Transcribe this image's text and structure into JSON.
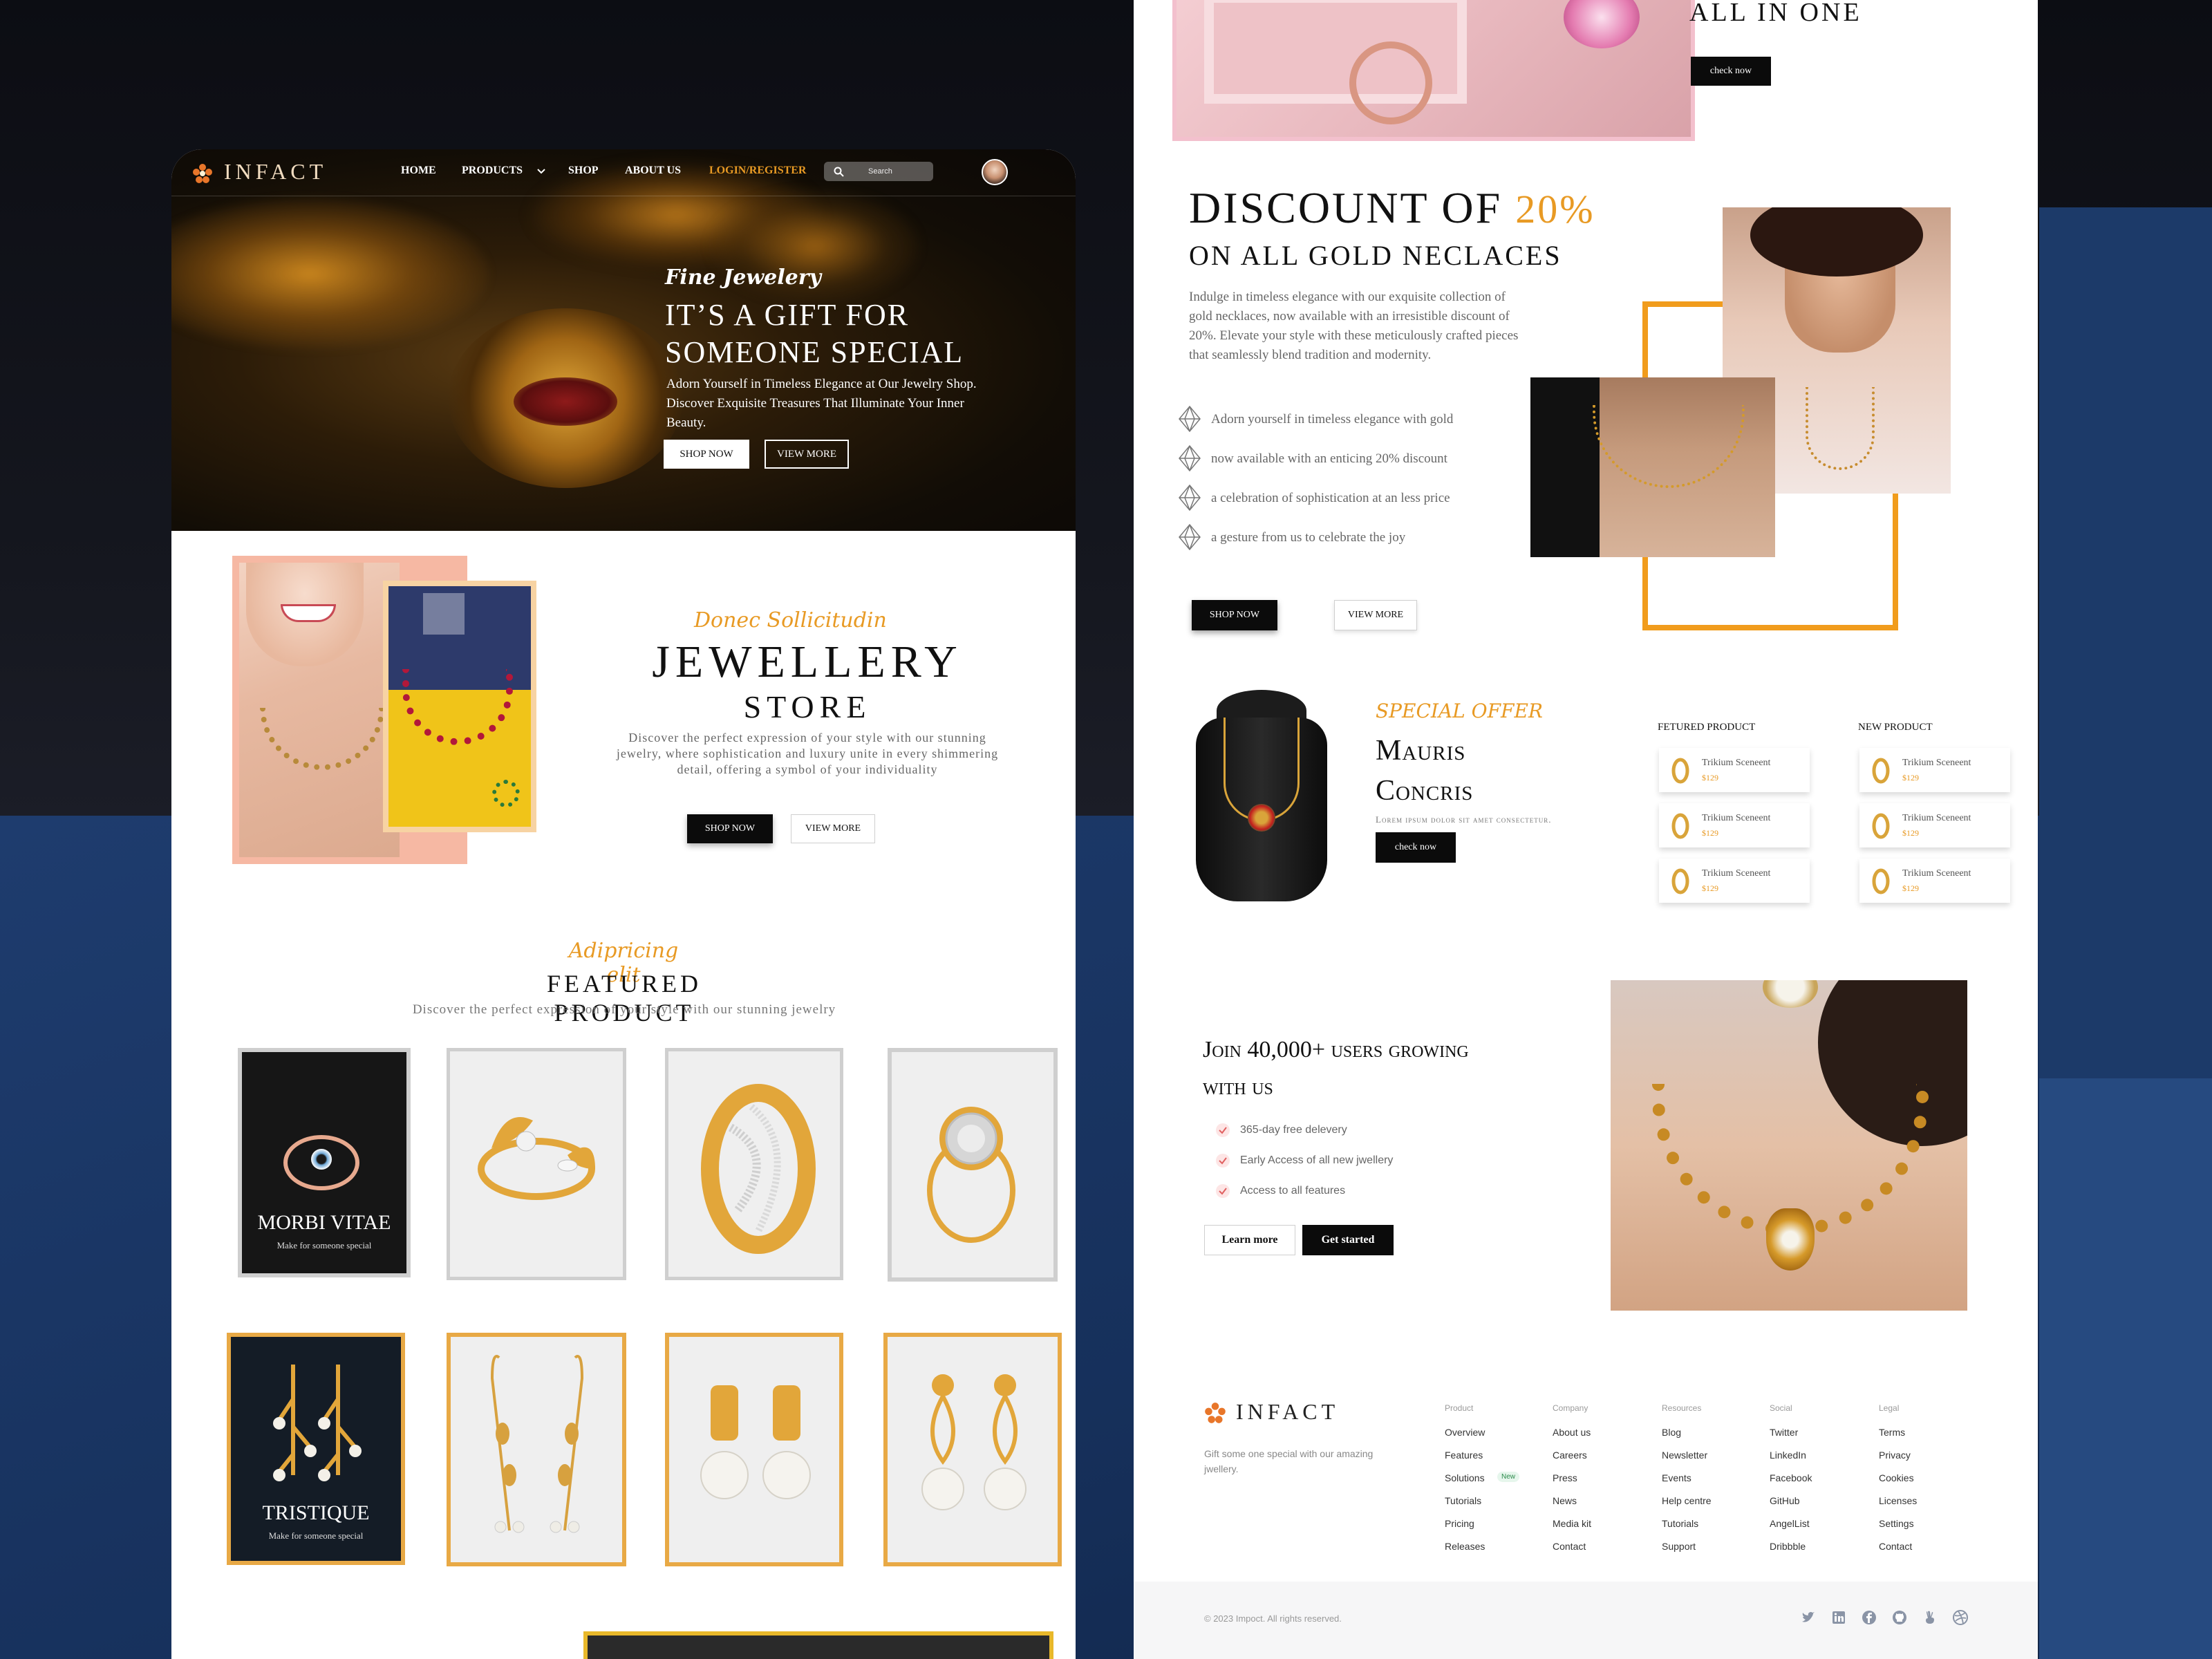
{
  "brand": {
    "name": "INFACT"
  },
  "nav": {
    "home": "HOME",
    "products": "PRODUCTS",
    "shop": "SHOP",
    "about": "ABOUT US",
    "login": "LOGIN/REGISTER",
    "search_placeholder": "Search"
  },
  "hero": {
    "script": "Fine Jewelery",
    "title_line1": "IT’S A GIFT FOR",
    "title_line2": "SOMEONE  SPECIAL",
    "desc": "Adorn Yourself in Timeless Elegance at Our Jewelry Shop. Discover Exquisite Treasures That Illuminate Your Inner Beauty.",
    "shop_now": "SHOP NOW",
    "view_more": "VIEW MORE"
  },
  "store": {
    "script": "Donec Sollicitudin",
    "title": "JEWELLERY",
    "subtitle": "STORE",
    "desc": "Discover the perfect expression of your style with our stunning jewelry, where sophistication and luxury unite in every shimmering detail, offering a symbol of your individuality",
    "shop_now": "SHOP NOW",
    "view_more": "VIEW MORE"
  },
  "featured": {
    "script": "Adipricing elit",
    "title": "FEATURED PRODUCT",
    "desc": "Discover the perfect expression of your style with our stunning jewelry",
    "card1": {
      "title": "MORBI VITAE",
      "sub": "Make for someone special"
    },
    "card5": {
      "title": "TRISTIQUE",
      "sub": "Make for someone special"
    }
  },
  "allinone": {
    "title": "ALL IN ONE",
    "button": "check now"
  },
  "discount": {
    "title_a": "DISCOUNT OF",
    "title_pct": "20%",
    "subtitle": "ON ALL GOLD NECLACES",
    "desc": "Indulge in timeless elegance with our exquisite collection of gold necklaces, now available with an irresistible discount of 20%. Elevate your style with these meticulously crafted pieces that seamlessly blend tradition and modernity.",
    "points": [
      "Adorn yourself in timeless elegance with gold",
      "now available with an enticing 20% discount",
      "a celebration of sophistication at an less price",
      "a gesture from us to celebrate the joy"
    ],
    "shop_now": "SHOP NOW",
    "view_more": "VIEW MORE"
  },
  "offer": {
    "script": "SPECIAL OFFER",
    "title_line1": "Mauris",
    "title_line2": "Concris",
    "desc": "Lorem ipsum dolor sit amet consectetur.",
    "button": "check now",
    "featured_heading": "FETURED PRODUCT",
    "new_heading": "NEW PRODUCT",
    "item_name": "Trikium Sceneent",
    "item_price": "$129"
  },
  "join": {
    "title_line1": "Join 40,000+ users growing",
    "title_line2": "with us",
    "features": [
      "365-day free delevery",
      "Early Access of all new jwellery",
      "Access to all features"
    ],
    "learn_more": "Learn more",
    "get_started": "Get started"
  },
  "footer": {
    "tagline": "Gift some one special with our amazing jwellery.",
    "columns": [
      {
        "heading": "Product",
        "items": [
          "Overview",
          "Features",
          "Solutions",
          "Tutorials",
          "Pricing",
          "Releases"
        ]
      },
      {
        "heading": "Company",
        "items": [
          "About us",
          "Careers",
          "Press",
          "News",
          "Media kit",
          "Contact"
        ]
      },
      {
        "heading": "Resources",
        "items": [
          "Blog",
          "Newsletter",
          "Events",
          "Help centre",
          "Tutorials",
          "Support"
        ]
      },
      {
        "heading": "Social",
        "items": [
          "Twitter",
          "LinkedIn",
          "Facebook",
          "GitHub",
          "AngelList",
          "Dribbble"
        ]
      },
      {
        "heading": "Legal",
        "items": [
          "Terms",
          "Privacy",
          "Cookies",
          "Licenses",
          "Settings",
          "Contact"
        ]
      }
    ],
    "new_badge": "New",
    "copyright": "© 2023 Impoct. All rights reserved.",
    "social_icons": [
      "twitter-icon",
      "linkedin-icon",
      "facebook-icon",
      "github-icon",
      "angellist-icon",
      "dribbble-icon"
    ]
  },
  "colors": {
    "accent": "#e89a24",
    "dark": "#0b0b0b",
    "pink_frame": "#f4b9a6",
    "gold_frame": "#e8a945"
  }
}
